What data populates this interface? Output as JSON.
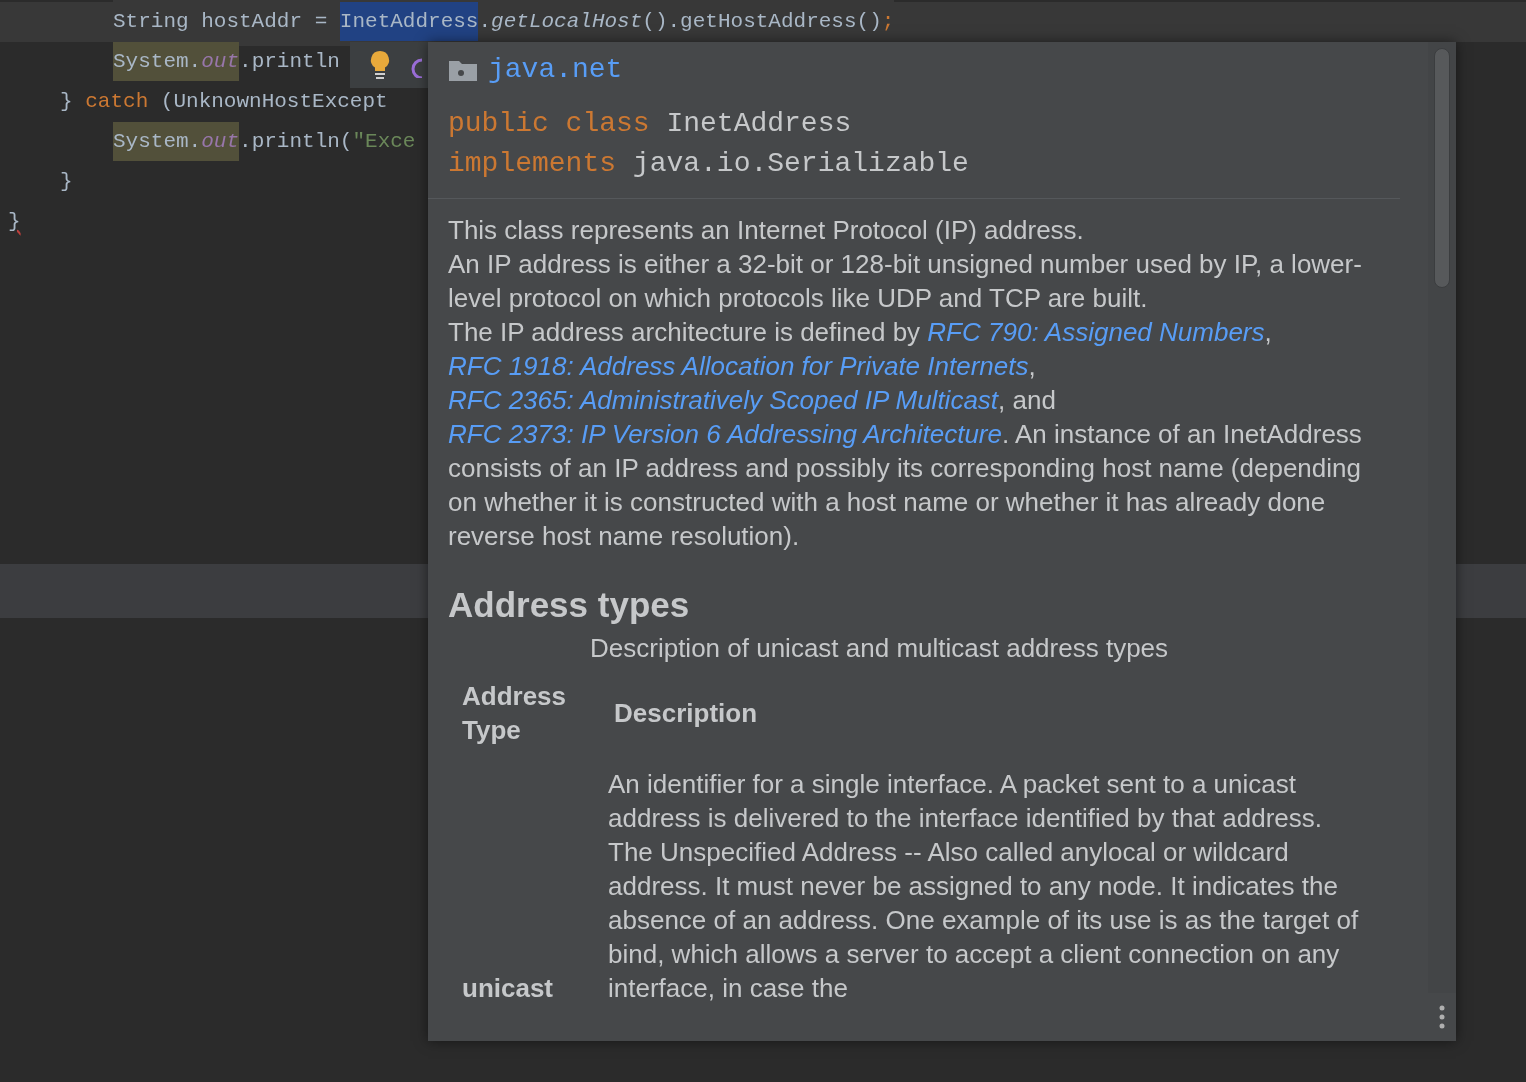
{
  "editor": {
    "lines": [
      {
        "children": [
          {
            "children": [
              {
                "current": true,
                "error": false,
                "tokens": [
                  {
                    "text": "String hostAddr = ",
                    "kind": "plain"
                  },
                  {
                    "text": "InetAddress",
                    "kind": "selected"
                  },
                  {
                    "text": ".",
                    "kind": "plain"
                  },
                  {
                    "text": "getLocalHost",
                    "kind": "static-method"
                  },
                  {
                    "text": "().getHostAddress()",
                    "kind": "plain"
                  },
                  {
                    "text": ";",
                    "kind": "keyword"
                  }
                ]
              },
              {
                "current": false,
                "error": false,
                "tokens": [
                  {
                    "text": "System.",
                    "kind": "highlight"
                  },
                  {
                    "text": "out",
                    "kind": "highlight-field"
                  },
                  {
                    "text": ".println",
                    "kind": "plain"
                  }
                ]
              }
            ]
          },
          {
            "current": false,
            "error": false,
            "tokens": [
              {
                "text": "} ",
                "kind": "plain"
              },
              {
                "text": "catch",
                "kind": "keyword"
              },
              {
                "text": " (UnknownHostExcept",
                "kind": "plain"
              }
            ]
          },
          {
            "children": [
              {
                "current": false,
                "error": false,
                "tokens": [
                  {
                    "text": "System.",
                    "kind": "highlight"
                  },
                  {
                    "text": "out",
                    "kind": "highlight-field"
                  },
                  {
                    "text": ".println(",
                    "kind": "plain"
                  },
                  {
                    "text": "\"Exce",
                    "kind": "string"
                  }
                ]
              }
            ]
          },
          {
            "current": false,
            "error": false,
            "tokens": [
              {
                "text": "}",
                "kind": "plain"
              }
            ]
          }
        ]
      },
      {
        "current": false,
        "error": true,
        "tokens": [
          {
            "text": "}",
            "kind": "plain"
          }
        ]
      }
    ]
  },
  "doc": {
    "package": "java.net",
    "signature": [
      [
        {
          "text": "public class ",
          "kind": "keyword"
        },
        {
          "text": "InetAddress",
          "kind": "plain"
        }
      ],
      [
        {
          "text": "implements ",
          "kind": "keyword"
        },
        {
          "text": "java.io.Serializable",
          "kind": "plain"
        }
      ]
    ],
    "paragraphs": [
      [
        {
          "text": "This class represents an Internet Protocol (IP) address.",
          "kind": "text"
        }
      ],
      [
        {
          "text": "An IP address is either a 32-bit or 128-bit unsigned number used by IP, a lower-level protocol on which protocols like UDP and TCP are built.",
          "kind": "text"
        }
      ],
      [
        {
          "text": "The IP address architecture is defined by ",
          "kind": "text"
        },
        {
          "text": "RFC 790: Assigned Numbers",
          "kind": "link"
        },
        {
          "text": ", ",
          "kind": "text"
        },
        {
          "text": "RFC 1918: Address Allocation for Private Internets",
          "kind": "link"
        },
        {
          "text": ", ",
          "kind": "text"
        },
        {
          "text": "RFC 2365: Administratively Scoped IP Multicast",
          "kind": "link"
        },
        {
          "text": ", and ",
          "kind": "text"
        },
        {
          "text": "RFC 2373: IP Version 6 Addressing Architecture",
          "kind": "link"
        },
        {
          "text": ". An instance of an InetAddress consists of an IP address and possibly its corresponding host name (depending on whether it is constructed with a host name or whether it has already done reverse host name resolution).",
          "kind": "text"
        }
      ]
    ],
    "section_title": "Address types",
    "table": {
      "caption": "Description of unicast and multicast address types",
      "columns": [
        "Address Type",
        "Description"
      ],
      "rows": [
        {
          "type": "unicast",
          "description": [
            "An identifier for a single interface. A packet sent to a unicast address is delivered to the interface identified by that address.",
            "The Unspecified Address -- Also called anylocal or wildcard address. It must never be assigned to any node. It indicates the absence of an address. One example of its use is as the target of bind, which allows a server to accept a client connection on any interface, in case the"
          ]
        }
      ]
    }
  }
}
